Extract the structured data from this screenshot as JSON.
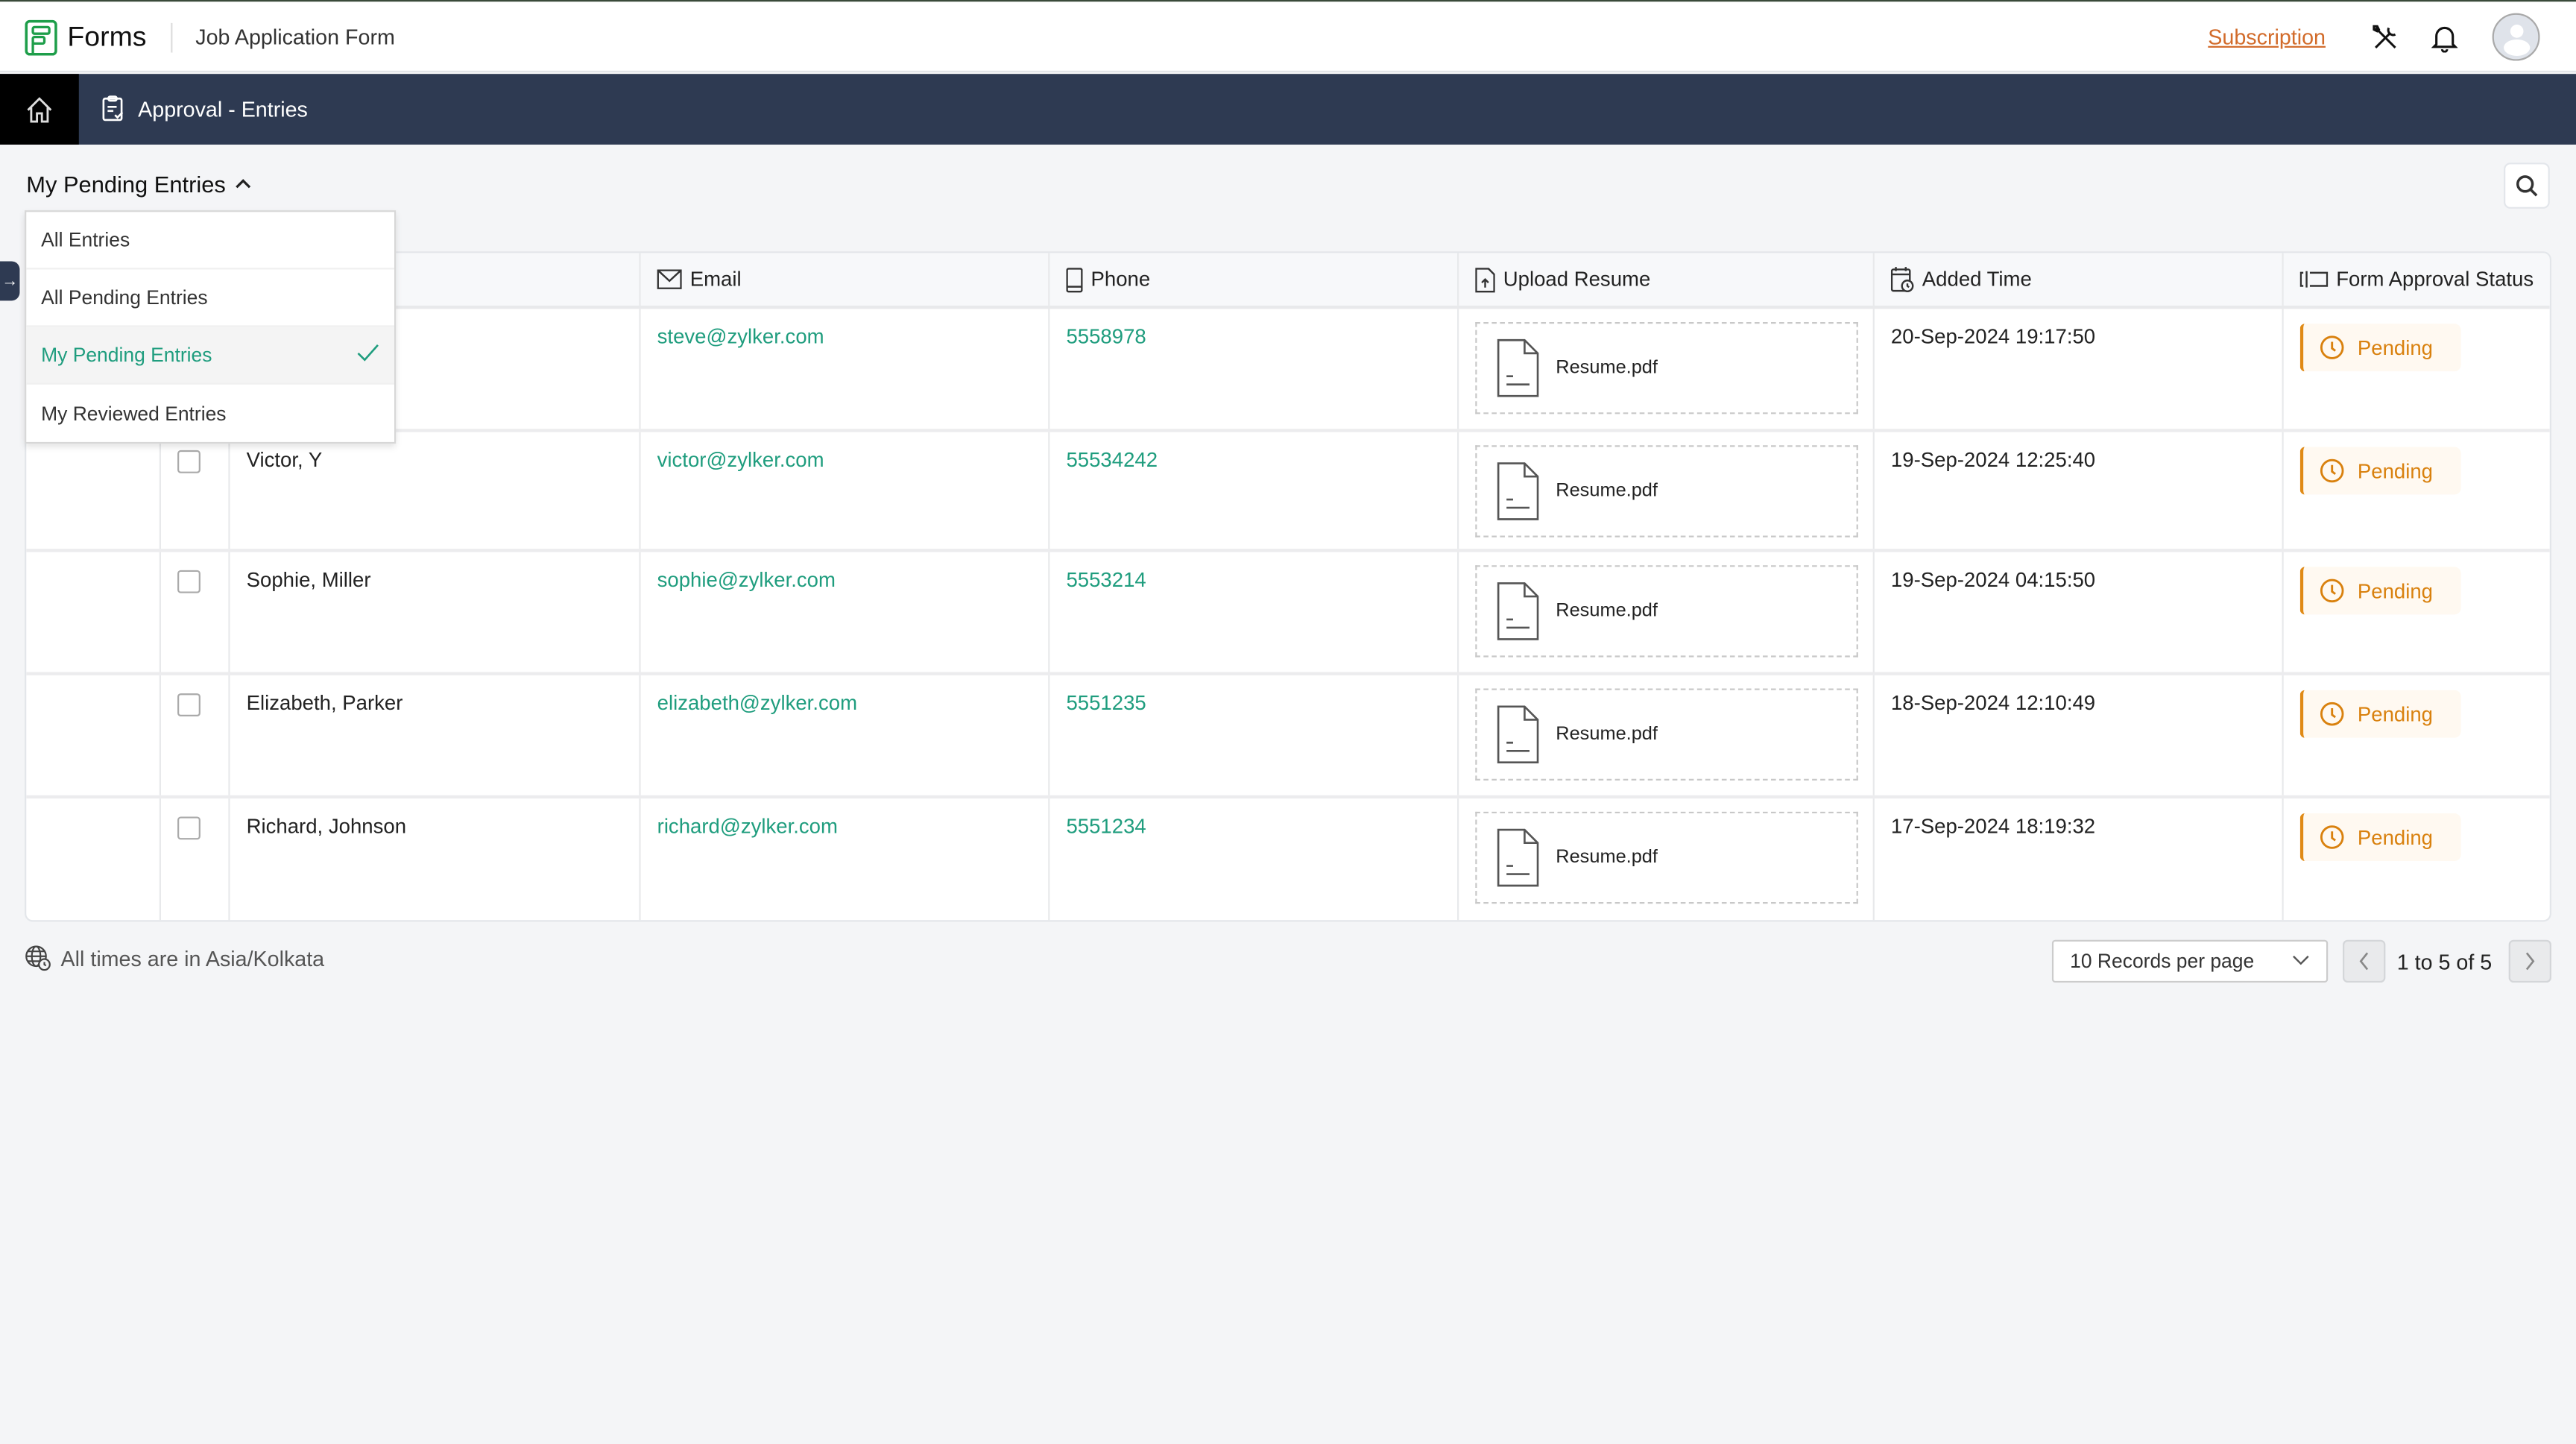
{
  "app": {
    "brand": "Forms",
    "form_title": "Job Application Form",
    "subscription_label": "Subscription",
    "accent_color": "#1f9d7e",
    "subscription_color": "#d26b2a"
  },
  "navbar": {
    "title": "Approval - Entries"
  },
  "view_selector": {
    "current": "My Pending Entries",
    "options": [
      {
        "label": "All Entries",
        "selected": false
      },
      {
        "label": "All Pending Entries",
        "selected": false
      },
      {
        "label": "My Pending Entries",
        "selected": true
      },
      {
        "label": "My Reviewed Entries",
        "selected": false
      }
    ]
  },
  "table": {
    "columns": [
      {
        "label": "",
        "icon": "none"
      },
      {
        "label": "Email",
        "icon": "envelope-icon"
      },
      {
        "label": "Phone",
        "icon": "phone-icon"
      },
      {
        "label": "Upload Resume",
        "icon": "file-upload-icon"
      },
      {
        "label": "Added Time",
        "icon": "calendar-clock-icon"
      },
      {
        "label": "Form Approval Status",
        "icon": "status-icon"
      }
    ],
    "rows": [
      {
        "name": "",
        "email": "steve@zylker.com",
        "phone": "5558978",
        "file": "Resume.pdf",
        "added": "20-Sep-2024 19:17:50",
        "status": "Pending"
      },
      {
        "name": "Victor, Y",
        "email": "victor@zylker.com",
        "phone": "55534242",
        "file": "Resume.pdf",
        "added": "19-Sep-2024 12:25:40",
        "status": "Pending"
      },
      {
        "name": "Sophie, Miller",
        "email": "sophie@zylker.com",
        "phone": "5553214",
        "file": "Resume.pdf",
        "added": "19-Sep-2024 04:15:50",
        "status": "Pending"
      },
      {
        "name": "Elizabeth, Parker",
        "email": "elizabeth@zylker.com",
        "phone": "5551235",
        "file": "Resume.pdf",
        "added": "18-Sep-2024 12:10:49",
        "status": "Pending"
      },
      {
        "name": "Richard, Johnson",
        "email": "richard@zylker.com",
        "phone": "5551234",
        "file": "Resume.pdf",
        "added": "17-Sep-2024 18:19:32",
        "status": "Pending"
      }
    ]
  },
  "footer": {
    "timezone_note": "All times are in Asia/Kolkata",
    "per_page": "10 Records per page",
    "pagination": "1 to 5 of 5"
  }
}
